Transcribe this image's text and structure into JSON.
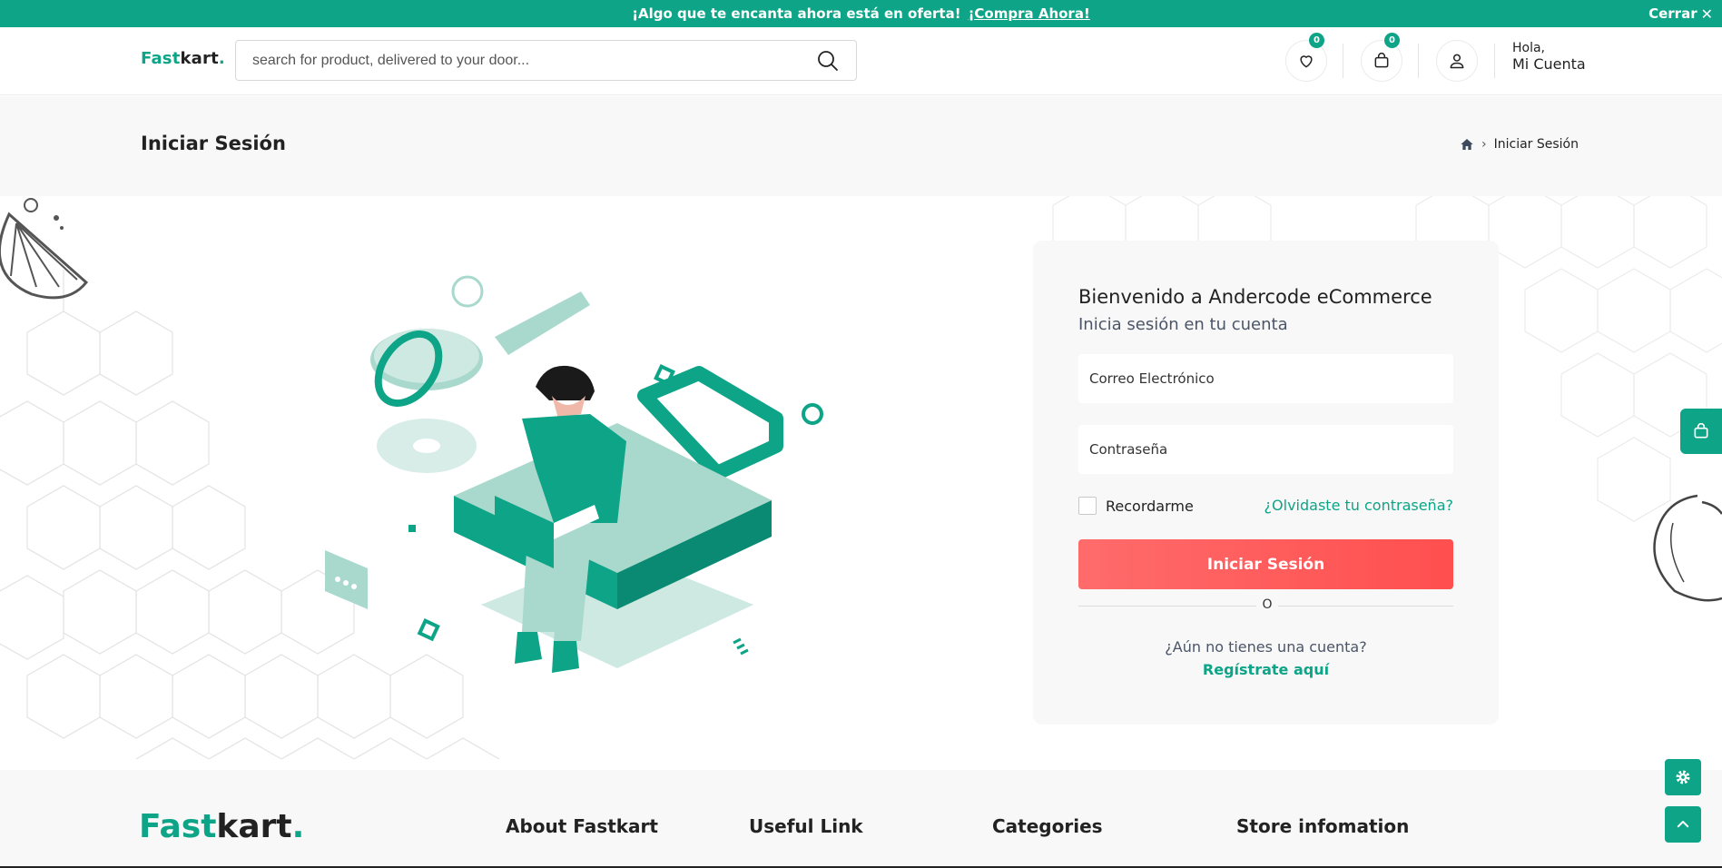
{
  "promo": {
    "text": "¡Algo que te encanta ahora está en oferta!",
    "link": "¡Compra Ahora!",
    "close_label": "Cerrar"
  },
  "header": {
    "logo_part1": "Fast",
    "logo_part2": "kart",
    "logo_dot": ".",
    "search_placeholder": "search for product, delivered to your door...",
    "wishlist_count": "0",
    "cart_count": "0",
    "greeting": "Hola,",
    "account_label": "Mi Cuenta"
  },
  "breadcrumb": {
    "page_title": "Iniciar Sesión",
    "current": "Iniciar Sesión"
  },
  "login": {
    "title": "Bienvenido a Andercode eCommerce",
    "subtitle": "Inicia sesión en tu cuenta",
    "email_placeholder": "Correo Electrónico",
    "password_placeholder": "Contraseña",
    "remember_label": "Recordarme",
    "forgot_label": "¿Olvidaste tu contraseña?",
    "submit_label": "Iniciar Sesión",
    "or_label": "O",
    "no_account": "¿Aún no tienes una cuenta?",
    "register_label": "Regístrate aquí"
  },
  "footer": {
    "logo_part1": "Fast",
    "logo_part2": "kart",
    "logo_dot": ".",
    "col1": "About Fastkart",
    "col2": "Useful Link",
    "col3": "Categories",
    "col4": "Store infomation"
  },
  "colors": {
    "brand": "#0da487",
    "danger": "#ff4f4f",
    "band_bg": "#f8f8f8"
  },
  "icons": [
    "close-icon",
    "search-icon",
    "heart-icon",
    "bag-icon",
    "user-icon",
    "home-icon",
    "chevron-right-icon",
    "gear-icon",
    "chevron-up-icon"
  ]
}
